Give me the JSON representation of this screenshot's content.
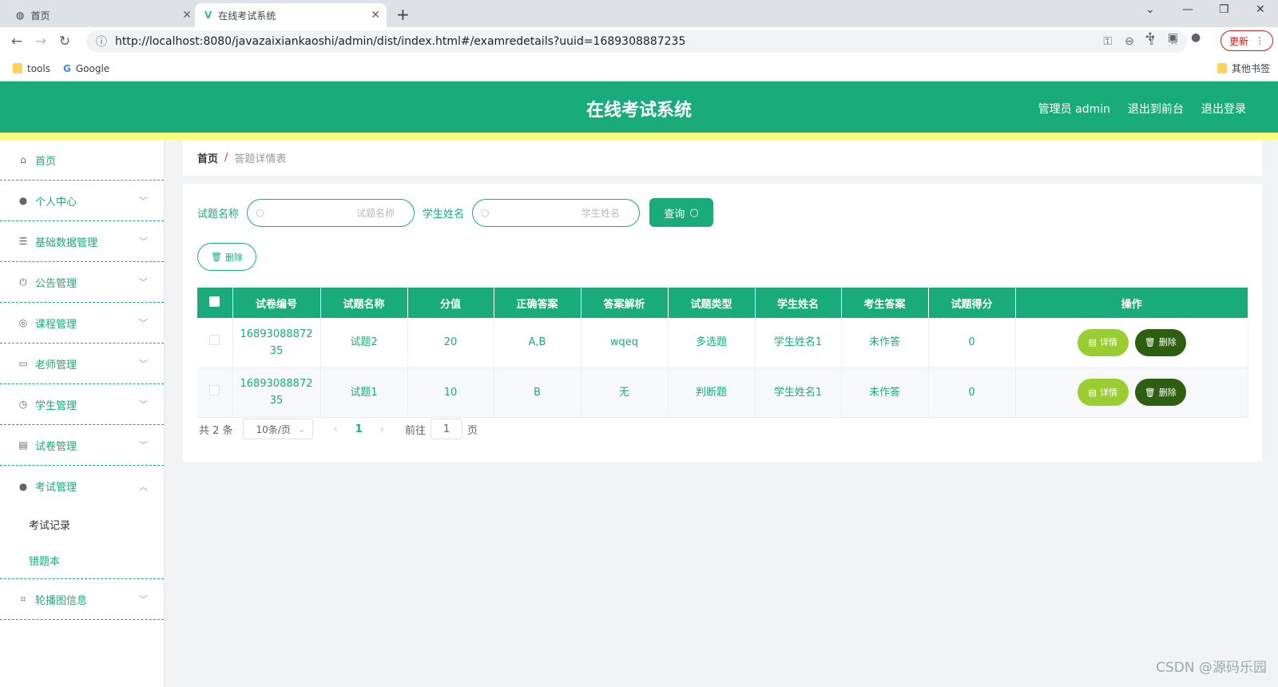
{
  "browser": {
    "tabs": [
      {
        "title": "首页",
        "close": "✕"
      },
      {
        "title": "在线考试系统",
        "close": "✕"
      }
    ],
    "new_tab": "+",
    "url": "http://localhost:8080/javazaixiankaoshi/admin/dist/index.html#/examredetails?uuid=1689308887235",
    "update_label": "更新",
    "bookmarks": [
      "tools",
      "Google"
    ],
    "other_bookmarks": "其他书签"
  },
  "header": {
    "title": "在线考试系统",
    "links": [
      "管理员 admin",
      "退出到前台",
      "退出登录"
    ]
  },
  "sidebar": {
    "items": [
      {
        "label": "首页",
        "icon": "home-icon"
      },
      {
        "label": "个人中心",
        "icon": "user-icon"
      },
      {
        "label": "基础数据管理",
        "icon": "sliders-icon"
      },
      {
        "label": "公告管理",
        "icon": "power-icon"
      },
      {
        "label": "课程管理",
        "icon": "target-icon"
      },
      {
        "label": "老师管理",
        "icon": "card-icon"
      },
      {
        "label": "学生管理",
        "icon": "compass-icon"
      },
      {
        "label": "试卷管理",
        "icon": "clipboard-icon"
      },
      {
        "label": "考试管理",
        "icon": "user-icon"
      },
      {
        "label": "轮播图信息",
        "icon": "crop-icon"
      }
    ],
    "exam_sub": [
      "考试记录",
      "错题本"
    ]
  },
  "breadcrumb": {
    "home": "首页",
    "sep": "/",
    "current": "答题详情表"
  },
  "search": {
    "label1": "试题名称",
    "placeholder1": "试题名称",
    "label2": "学生姓名",
    "placeholder2": "学生姓名",
    "query": "查询",
    "delete": "删除"
  },
  "table": {
    "headers": [
      "试卷编号",
      "试题名称",
      "分值",
      "正确答案",
      "答案解析",
      "试题类型",
      "学生姓名",
      "考生答案",
      "试题得分",
      "操作"
    ],
    "rows": [
      {
        "paper_no": "1689308887235",
        "question": "试题2",
        "score": "20",
        "answer": "A,B",
        "analysis": "wqeq",
        "type": "多选题",
        "student": "学生姓名1",
        "student_answer": "未作答",
        "got": "0"
      },
      {
        "paper_no": "1689308887235",
        "question": "试题1",
        "score": "10",
        "answer": "B",
        "analysis": "无",
        "type": "判断题",
        "student": "学生姓名1",
        "student_answer": "未作答",
        "got": "0"
      }
    ],
    "detail_label": "详情",
    "delete_label": "删除"
  },
  "pager": {
    "total": "共 2 条",
    "size": "10条/页",
    "current": "1",
    "goto": "前往",
    "goto_value": "1",
    "page_unit": "页"
  },
  "watermark": "CSDN @源码乐园"
}
